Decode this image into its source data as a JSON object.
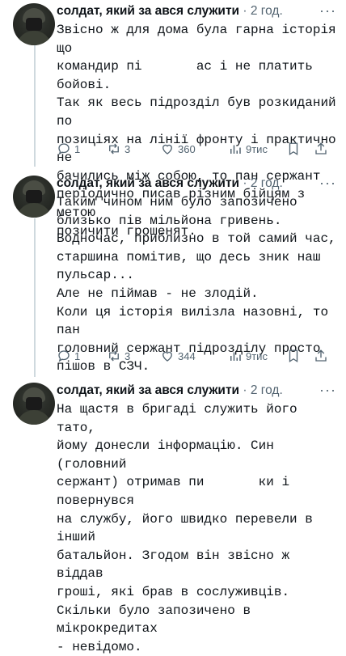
{
  "tweets": [
    {
      "author_name": "солдат, який за    ався служити",
      "time": "2 год.",
      "body": "Звісно ж для дома була гарна історія що\nкомандир пі       ас і не платить бойові.\nТак як весь підрозділ був розкиданий по\nпозиціях на лінії фронту і практично не\nбачились між собою, то пан сержант\nперіодично писав різним бійцям з метою\nпозичити грошенят.",
      "replies": "1",
      "reposts": "3",
      "likes": "360",
      "views": "9тис"
    },
    {
      "author_name": "солдат, який за    ався служити",
      "time": "2 год.",
      "body": "Таким чином ним було запозичено\nблизько пів мільйона гривень.\nВодночас, приблизно в той самий час,\nстаршина помітив, що десь зник наш\nпульсар...\nАле не піймав - не злодій.\nКоли ця історія вилізла назовні, то пан\nголовний сержант підрозділу просто\nпішов в СЗЧ.",
      "replies": "1",
      "reposts": "3",
      "likes": "344",
      "views": "9тис"
    },
    {
      "author_name": "солдат, який за    ався служити",
      "time": "2 год.",
      "body": "На щастя в бригаді служить його тато,\nйому донесли інформацію. Син (головний\nсержант) отримав пи       ки і повернувся\nна службу, його швидко перевели в інший\nбатальйон. Згодом він звісно ж віддав\nгроші, які брав в сослуживців.\nСкільки було запозичено в мікрокредитах\n- невідомо.",
      "replies": "",
      "reposts": "",
      "likes": "",
      "views": ""
    }
  ],
  "icons": {
    "reply": "reply-icon",
    "repost": "repost-icon",
    "like": "like-icon",
    "views": "views-icon",
    "bookmark": "bookmark-icon",
    "share": "share-icon",
    "more": "more-icon"
  },
  "colors": {
    "text": "#0f1419",
    "muted": "#536471",
    "thread_line": "#cfd9de"
  }
}
